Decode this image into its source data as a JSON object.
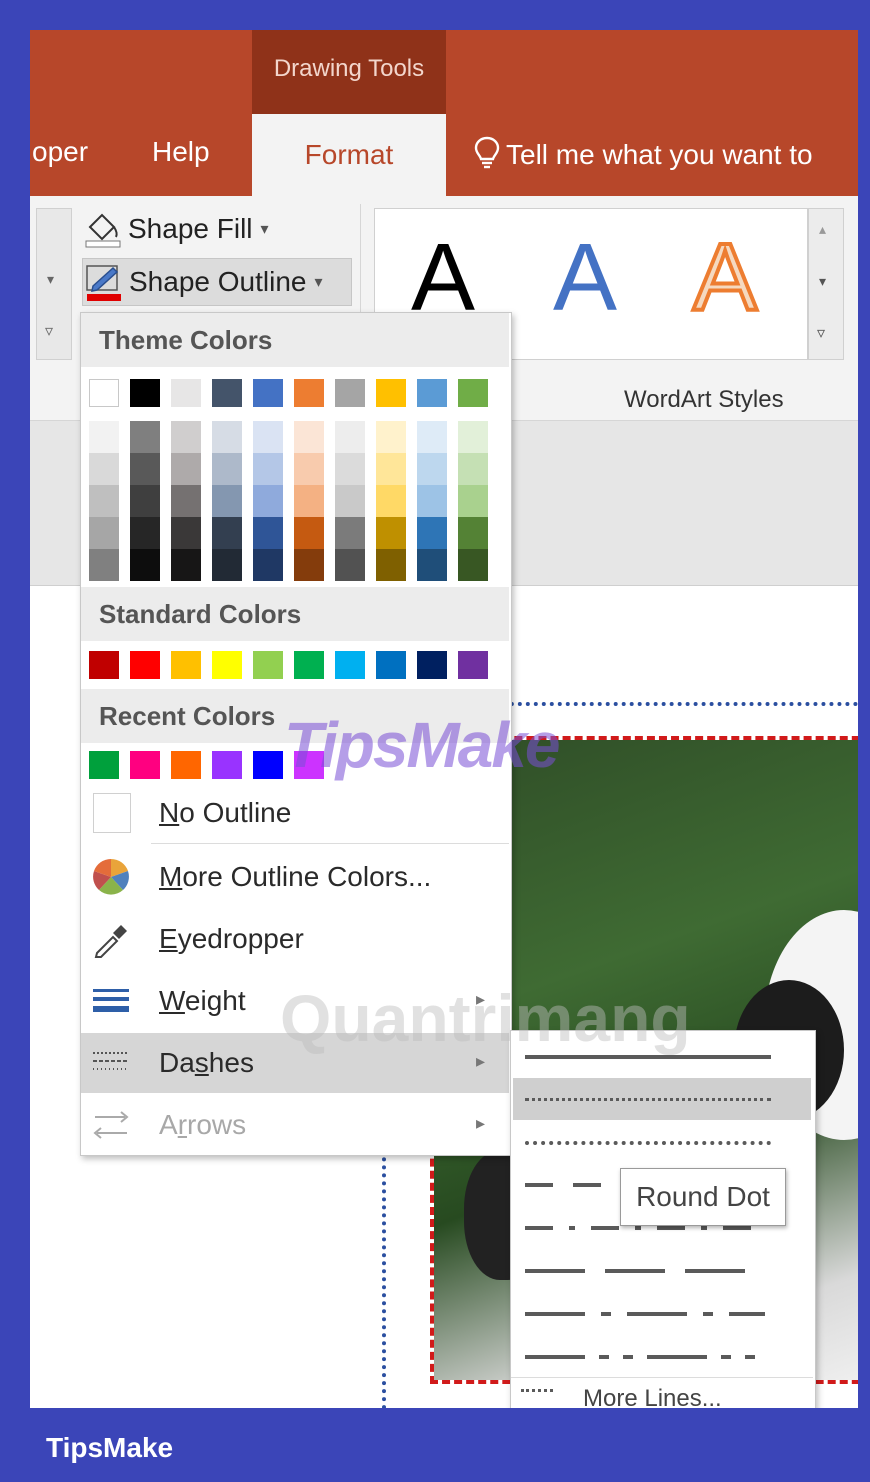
{
  "titlebar": {
    "context_group": "Drawing Tools"
  },
  "tabs": {
    "developer_partial": "oper",
    "help": "Help",
    "format": "Format",
    "tell_me": "Tell me what you want to"
  },
  "ribbon": {
    "shape_fill": "Shape Fill",
    "shape_outline": "Shape Outline",
    "wordart_letters": [
      "A",
      "A",
      "A"
    ],
    "wordart_group_label": "WordArt Styles"
  },
  "outline_menu": {
    "theme_header": "Theme Colors",
    "theme_top_row": [
      "#ffffff",
      "#000000",
      "#e7e6e6",
      "#44546a",
      "#4472c4",
      "#ed7d31",
      "#a5a5a5",
      "#ffc000",
      "#5b9bd5",
      "#70ad47"
    ],
    "theme_shades": [
      [
        "#f2f2f2",
        "#d9d9d9",
        "#bfbfbf",
        "#a6a6a6",
        "#808080"
      ],
      [
        "#7f7f7f",
        "#595959",
        "#3f3f3f",
        "#262626",
        "#0d0d0d"
      ],
      [
        "#d0cece",
        "#aeaaaa",
        "#757171",
        "#3a3838",
        "#171616"
      ],
      [
        "#d6dce5",
        "#adb9ca",
        "#8497b0",
        "#333f50",
        "#222a35"
      ],
      [
        "#dae3f3",
        "#b4c7e7",
        "#8faadc",
        "#2f5597",
        "#1f3864"
      ],
      [
        "#fbe5d6",
        "#f8cbad",
        "#f4b183",
        "#c55a11",
        "#843c0c"
      ],
      [
        "#ededed",
        "#dbdbdb",
        "#c9c9c9",
        "#7b7b7b",
        "#525252"
      ],
      [
        "#fff2cc",
        "#ffe699",
        "#ffd966",
        "#bf9000",
        "#7f6000"
      ],
      [
        "#deebf7",
        "#bdd7ee",
        "#9dc3e6",
        "#2e75b6",
        "#1f4e79"
      ],
      [
        "#e2f0d9",
        "#c5e0b4",
        "#a9d18e",
        "#548235",
        "#385723"
      ]
    ],
    "standard_header": "Standard Colors",
    "standard": [
      "#c00000",
      "#ff0000",
      "#ffc000",
      "#ffff00",
      "#92d050",
      "#00b050",
      "#00b0f0",
      "#0070c0",
      "#002060",
      "#7030a0"
    ],
    "recent_header": "Recent Colors",
    "recent": [
      "#00a03c",
      "#ff0080",
      "#ff6600",
      "#9933ff",
      "#0000ff",
      "#cc33ff"
    ],
    "no_outline": {
      "u": "N",
      "rest": "o Outline"
    },
    "more_colors": {
      "u": "M",
      "rest": "ore Outline Colors..."
    },
    "eyedropper": {
      "u": "E",
      "rest": "yedropper"
    },
    "weight": {
      "u": "W",
      "rest": "eight"
    },
    "dashes": {
      "pre": "Da",
      "u": "s",
      "rest": "hes"
    },
    "arrows": {
      "pre": "A",
      "u": "r",
      "rest": "rows"
    }
  },
  "dashes_menu": {
    "styles": [
      "solid",
      "round-dot",
      "square-dot",
      "dash",
      "dash-dot",
      "long-dash",
      "long-dash-dot",
      "long-dash-dot-dot"
    ],
    "selected": "round-dot",
    "more_lines_partial": "More Lines..."
  },
  "tooltip": "Round Dot",
  "watermarks": {
    "tipsmake": "TipsMake",
    "quantrimang": "Quantrimang"
  },
  "brand": "TipsMake"
}
